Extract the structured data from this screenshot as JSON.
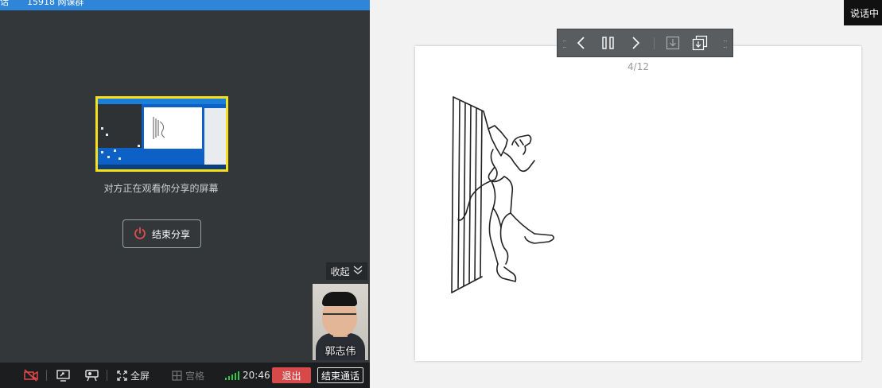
{
  "left_panel": {
    "top_bar": {
      "title_fragment_1": "话",
      "title_fragment_2": "15918 网课群"
    },
    "share_status_text": "对方正在观看你分享的屏幕",
    "stop_share_label": "结束分享",
    "collapse_label": "收起",
    "participant_name": "郭志伟",
    "bottom_bar": {
      "fullscreen_label": "全屏",
      "grid_label": "宫格",
      "time": "20:46",
      "exit_label": "退出",
      "end_call_label": "结束通话"
    }
  },
  "right_panel": {
    "speaking_label": "说话中",
    "page_indicator": "4/12"
  },
  "colors": {
    "accent_blue": "#2f86d9",
    "panel_dark": "#33373a",
    "exit_red": "#d84a4a",
    "signal_green": "#32c64a",
    "highlight_yellow": "#f6e01b"
  },
  "icons": {
    "camera_off": "camera-off-icon",
    "share_screen": "screen-share-icon",
    "projector": "projector-icon",
    "fullscreen": "fullscreen-icon",
    "grid": "grid-icon",
    "signal": "signal-icon",
    "power": "power-icon",
    "collapse": "double-chevron-down-icon",
    "prev": "chevron-left-icon",
    "pause": "pause-icon",
    "next": "chevron-right-icon",
    "download": "download-icon",
    "download_all": "download-all-icon"
  }
}
